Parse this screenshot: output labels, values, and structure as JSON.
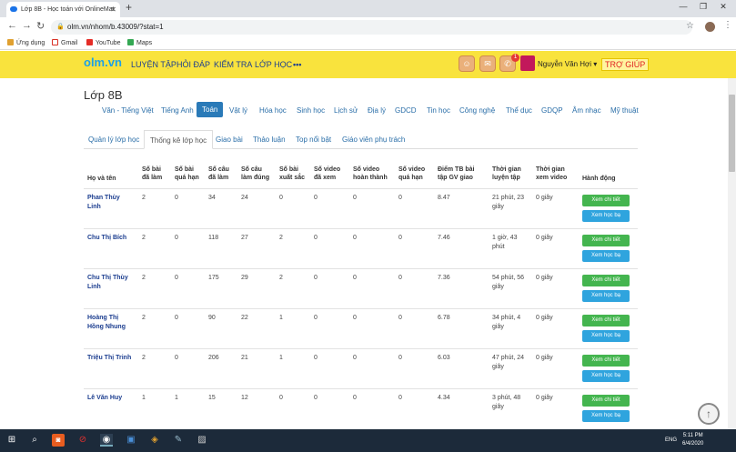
{
  "browser": {
    "tab_title": "Lớp 8B - Học toán với OnlineMat",
    "url": "olm.vn/nhom/b.43009/?stat=1",
    "bookmarks": [
      "Ứng dụng",
      "Gmail",
      "YouTube",
      "Maps"
    ]
  },
  "site": {
    "logo": "olm.vn",
    "nav": [
      "LUYỆN TẬP",
      "HỎI ĐÁP",
      "KIỂM TRA",
      "LỚP HỌC",
      "•••"
    ],
    "notif_count": "1",
    "user_name": "Nguyễn Văn Hợi ▾",
    "help": "TRỢ GIÚP"
  },
  "page": {
    "title": "Lớp 8B",
    "subjects": [
      "Văn - Tiếng Việt",
      "Tiếng Anh",
      "Toán",
      "Vật lý",
      "Hóa học",
      "Sinh học",
      "Lịch sử",
      "Địa lý",
      "GDCD",
      "Tin học",
      "Công nghệ",
      "Thể dục",
      "GDQP",
      "Âm nhạc",
      "Mỹ thuật"
    ],
    "active_subject": "Toán",
    "tabs": [
      "Quản lý lớp học",
      "Thống kê lớp học",
      "Giao bài",
      "Thảo luận",
      "Top nổi bật",
      "Giáo viên phụ trách"
    ],
    "active_tab": "Thống kê lớp học"
  },
  "table": {
    "headers": [
      [
        "Họ và tên"
      ],
      [
        "Số bài",
        "đã làm"
      ],
      [
        "Số bài",
        "quá hạn"
      ],
      [
        "Số câu",
        "đã làm"
      ],
      [
        "Số câu",
        "làm đúng"
      ],
      [
        "Số bài",
        "xuất sắc"
      ],
      [
        "Số video",
        "đã xem"
      ],
      [
        "Số video",
        "hoàn thành"
      ],
      [
        "Số video",
        "quá hạn"
      ],
      [
        "Điểm TB bài",
        "tập GV giao"
      ],
      [
        "Thời gian",
        "luyện tập"
      ],
      [
        "Thời gian",
        "xem video"
      ],
      [
        "Hành động"
      ]
    ],
    "btn_detail": "Xem chi tiết",
    "btn_learn": "Xem học bạ",
    "rows": [
      {
        "name": [
          "Phan Thùy",
          "Linh"
        ],
        "v": [
          "2",
          "0",
          "34",
          "24",
          "0",
          "0",
          "0",
          "0",
          "8.47"
        ],
        "time": [
          "21 phút, 23",
          "giây"
        ],
        "video": "0 giây"
      },
      {
        "name": [
          "Chu Thị Bích",
          ""
        ],
        "v": [
          "2",
          "0",
          "118",
          "27",
          "2",
          "0",
          "0",
          "0",
          "7.46"
        ],
        "time": [
          "1 giờ, 43",
          "phút"
        ],
        "video": "0 giây"
      },
      {
        "name": [
          "Chu Thị Thùy",
          "Linh"
        ],
        "v": [
          "2",
          "0",
          "175",
          "29",
          "2",
          "0",
          "0",
          "0",
          "7.36"
        ],
        "time": [
          "54 phút, 56",
          "giây"
        ],
        "video": "0 giây"
      },
      {
        "name": [
          "Hoàng Thị",
          "Hồng Nhung"
        ],
        "v": [
          "2",
          "0",
          "90",
          "22",
          "1",
          "0",
          "0",
          "0",
          "6.78"
        ],
        "time": [
          "34 phút, 4",
          "giây"
        ],
        "video": "0 giây"
      },
      {
        "name": [
          "Triệu Thị Trinh",
          ""
        ],
        "v": [
          "2",
          "0",
          "206",
          "21",
          "1",
          "0",
          "0",
          "0",
          "6.03"
        ],
        "time": [
          "47 phút, 24",
          "giây"
        ],
        "video": "0 giây"
      },
      {
        "name": [
          "Lê Văn Huy",
          ""
        ],
        "v": [
          "1",
          "1",
          "15",
          "12",
          "0",
          "0",
          "0",
          "0",
          "4.34"
        ],
        "time": [
          "3 phút, 48",
          "giây"
        ],
        "video": "0 giây"
      }
    ]
  },
  "taskbar": {
    "lang": "ENG",
    "time": "5:11 PM",
    "date": "6/4/2020"
  }
}
